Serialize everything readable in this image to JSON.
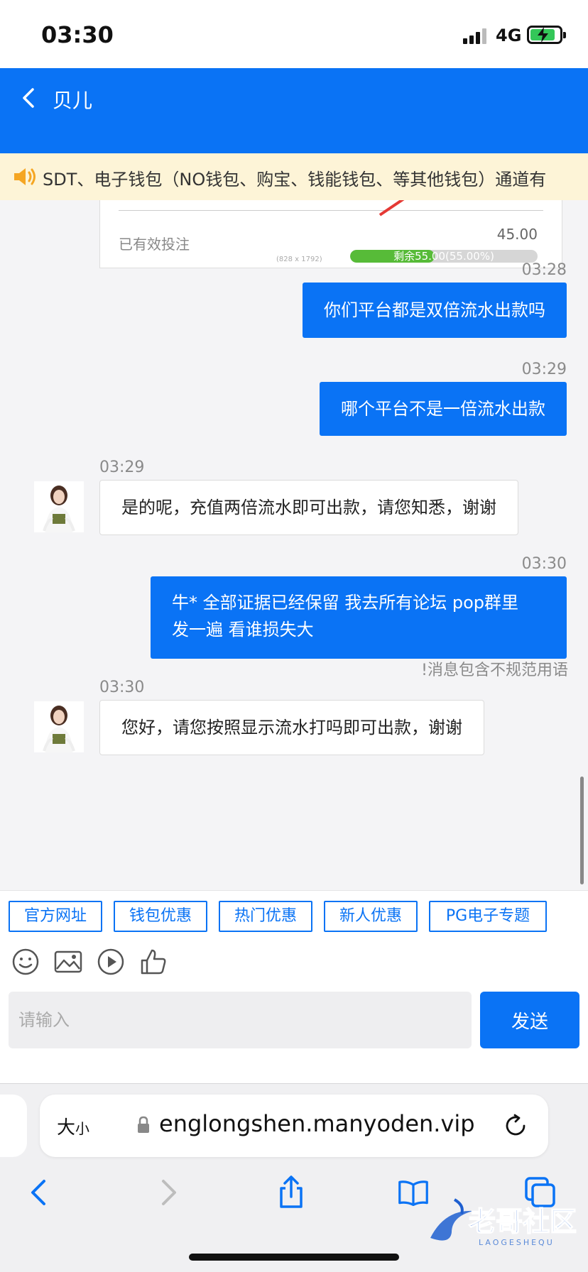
{
  "status_bar": {
    "time": "03:30",
    "network": "4G",
    "battery_level": 0.85
  },
  "header": {
    "title": "贝儿"
  },
  "notice": {
    "text": "SDT、电子钱包（NO钱包、购宝、钱能钱包、等其他钱包）通道有"
  },
  "card": {
    "label": "已有效投注",
    "amount": "45.00",
    "dims_text": "(828 x 1792)",
    "progress_text": "剩余55.00(55.00%)",
    "progress_fraction": 0.45
  },
  "messages": [
    {
      "time": "03:28",
      "text": "你们平台都是双倍流水出款吗"
    },
    {
      "time": "03:29",
      "text": "哪个平台不是一倍流水出款"
    },
    {
      "time": "03:29",
      "text": "是的呢，充值两倍流水即可出款，请您知悉，谢谢"
    },
    {
      "time": "03:30",
      "line1": "牛* 全部证据已经保留 我去所有论坛 pop群里",
      "line2": "发一遍 看谁损失大",
      "warning": "!消息包含不规范用语"
    },
    {
      "time": "03:30",
      "text": "您好，请您按照显示流水打吗即可出款，谢谢"
    }
  ],
  "quick_links": [
    "官方网址",
    "钱包优惠",
    "热门优惠",
    "新人优惠",
    "PG电子专题"
  ],
  "composer": {
    "placeholder": "请输入",
    "send_label": "发送"
  },
  "browser": {
    "text_size_big": "大",
    "text_size_small": "小",
    "url": "englongshen.manyoden.vip"
  },
  "watermark": {
    "title": "老哥社区",
    "subtitle": "LAOGESHEQU"
  },
  "colors": {
    "primary": "#0a73f5",
    "notice_bg": "#fdf4d7",
    "progress": "#57bb38"
  }
}
